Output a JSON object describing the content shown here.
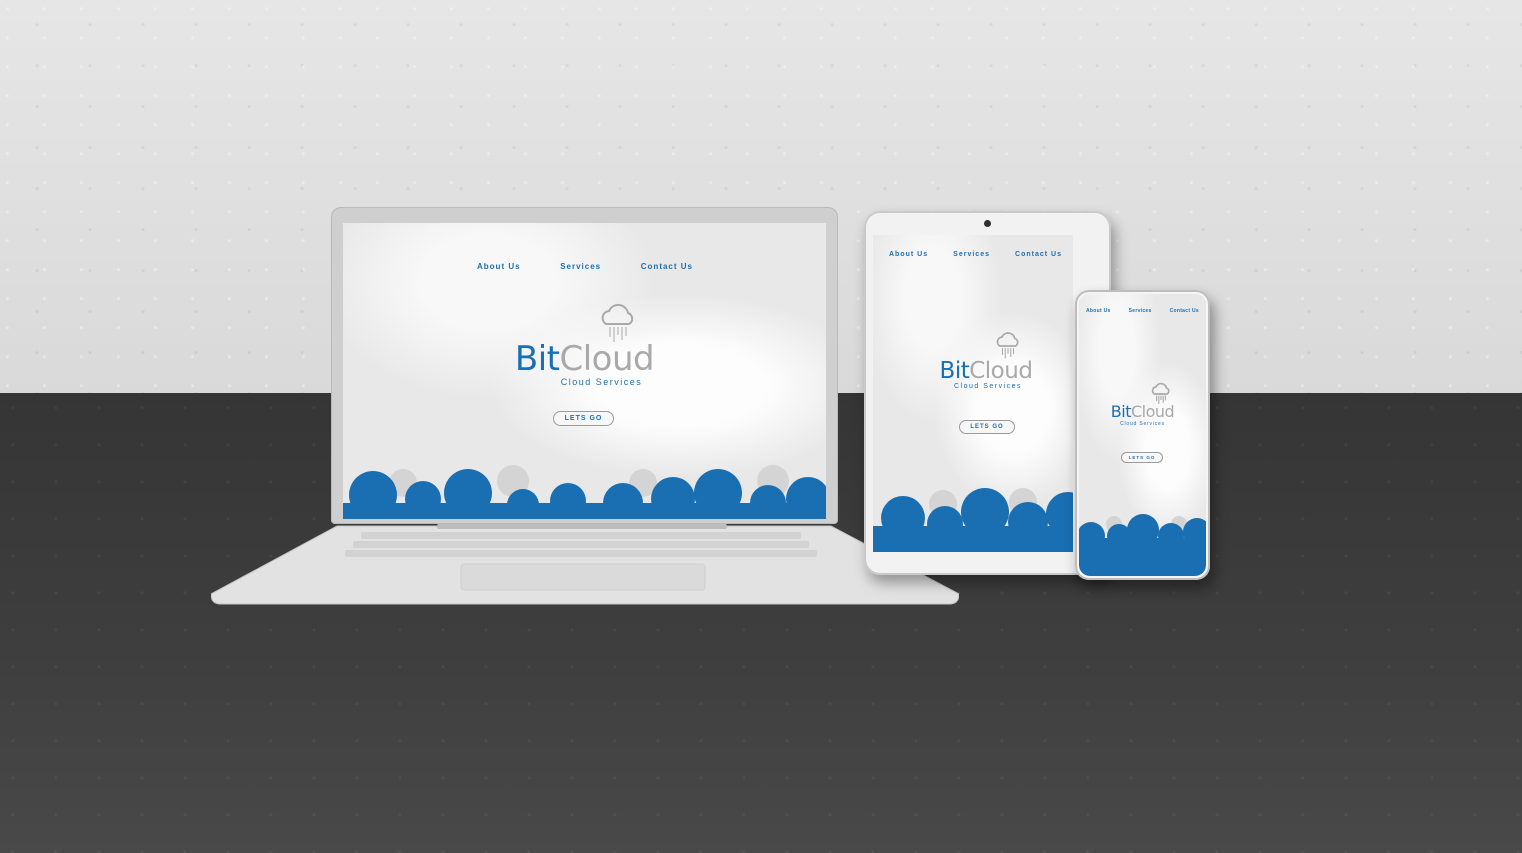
{
  "site": {
    "nav": [
      "About Us",
      "Services",
      "Contact Us"
    ],
    "brand_primary": "Bit",
    "brand_secondary": "Cloud",
    "tagline": "Cloud Services",
    "cta_label": "LETS GO"
  },
  "colors": {
    "brand_blue": "#1a6fb3",
    "brand_gray": "#a9a9a9",
    "wall": "#dcdcdc",
    "floor": "#3c3c3c"
  },
  "icons": {
    "logo": "cloud-rain-icon"
  }
}
